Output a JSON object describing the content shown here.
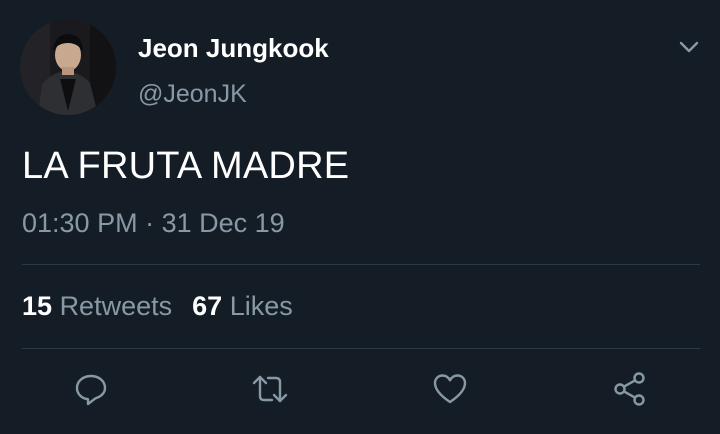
{
  "tweet": {
    "author_name": "Jeon Jungkook",
    "author_handle": "@JeonJK",
    "text": "LA FRUTA MADRE",
    "time": "01:30 PM",
    "separator": "·",
    "date": "31 Dec 19",
    "retweets_count": "15",
    "retweets_label": "Retweets",
    "likes_count": "67",
    "likes_label": "Likes"
  },
  "icons": {
    "avatar": "profile-photo",
    "menu": "chevron-down-icon",
    "reply": "reply-icon",
    "retweet": "retweet-icon",
    "like": "heart-icon",
    "share": "share-icon"
  },
  "colors": {
    "background": "#141d26",
    "primary_text": "#ffffff",
    "secondary_text": "#8899a6",
    "divider": "#2b3946"
  }
}
